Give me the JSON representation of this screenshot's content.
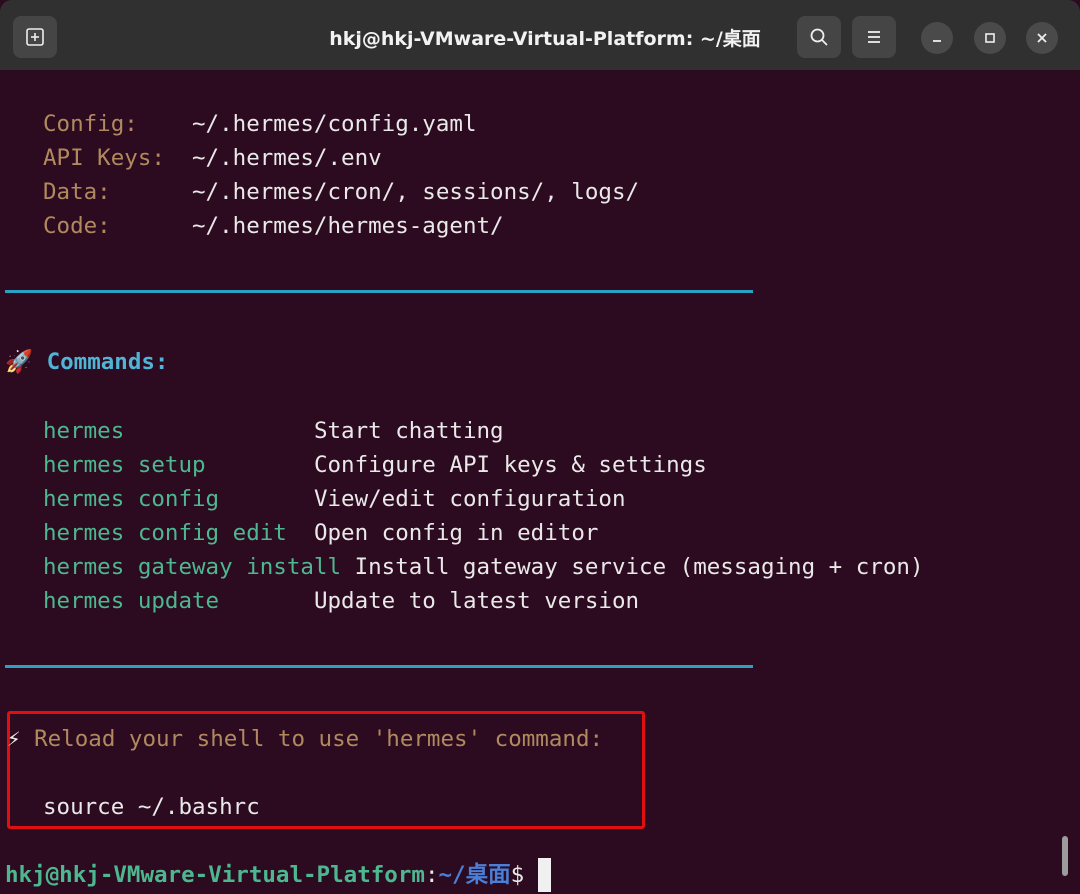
{
  "window": {
    "title": "hkj@hkj-VMware-Virtual-Platform: ~/桌面",
    "new_tab_icon": "new-tab-icon",
    "search_icon": "search-icon",
    "menu_icon": "hamburger-menu-icon",
    "minimize_icon": "minimize-icon",
    "maximize_icon": "maximize-icon",
    "close_icon": "close-icon"
  },
  "paths": [
    {
      "label": "Config:    ",
      "value": "~/.hermes/config.yaml"
    },
    {
      "label": "API Keys:  ",
      "value": "~/.hermes/.env"
    },
    {
      "label": "Data:      ",
      "value": "~/.hermes/cron/, sessions/, logs/"
    },
    {
      "label": "Code:      ",
      "value": "~/.hermes/hermes-agent/"
    }
  ],
  "commands_header": {
    "emoji": "🚀",
    "text": "Commands:"
  },
  "commands": [
    {
      "cmd": "hermes              ",
      "desc": "Start chatting"
    },
    {
      "cmd": "hermes setup        ",
      "desc": "Configure API keys & settings"
    },
    {
      "cmd": "hermes config       ",
      "desc": "View/edit configuration"
    },
    {
      "cmd": "hermes config edit  ",
      "desc": "Open config in editor"
    },
    {
      "cmd": "hermes gateway install ",
      "desc": "Install gateway service (messaging + cron)"
    },
    {
      "cmd": "hermes update       ",
      "desc": "Update to latest version"
    }
  ],
  "reload": {
    "emoji": "⚡",
    "message": " Reload your shell to use 'hermes' command:",
    "command": "source ~/.bashrc"
  },
  "prompt": {
    "user_host": "hkj@hkj-VMware-Virtual-Platform",
    "colon": ":",
    "path": "~/桌面",
    "symbol": "$ "
  },
  "colors": {
    "background": "#2c0a1f",
    "label": "#b08a5e",
    "command": "#4db890",
    "header": "#4fb4d6",
    "separator": "#2aa0c2",
    "highlight_box": "#e01010",
    "prompt_path": "#4a7fd8"
  }
}
